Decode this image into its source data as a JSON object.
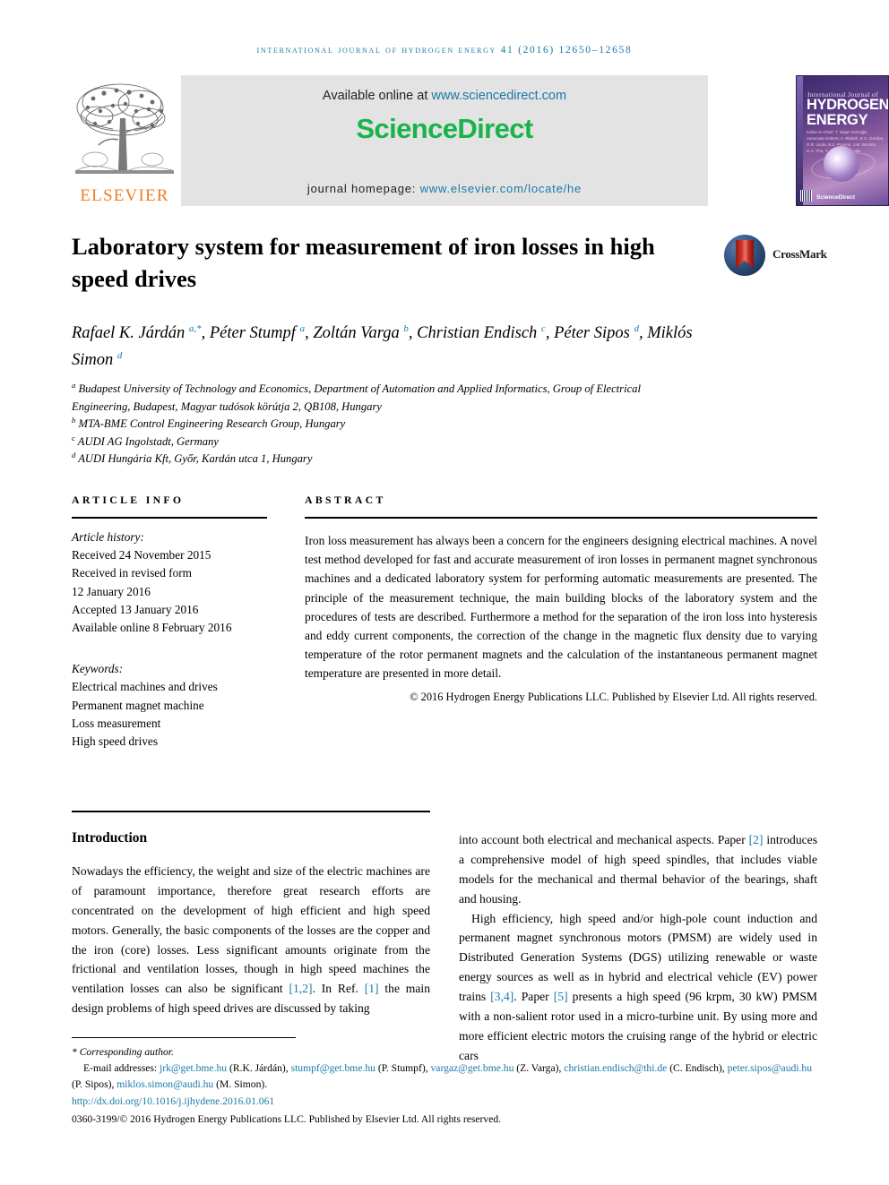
{
  "running_head": "International Journal of Hydrogen Energy 41 (2016) 12650–12658",
  "masthead": {
    "publisher_name": "ELSEVIER",
    "available_prefix": "Available online at ",
    "available_url": "www.sciencedirect.com",
    "sciencedirect_part1": "Science",
    "sciencedirect_part2": "Direct",
    "homepage_label": "journal homepage: ",
    "homepage_url": "www.elsevier.com/locate/he",
    "cover": {
      "line_small": "International Journal of",
      "line_big1": "HYDROGEN",
      "line_big2": "ENERGY",
      "editors": "Editor-in-Chief: T. Nejat Veziroğlu\nAssociate Editors: A. Bloksh, E.C. Gordon, D.R. Linda,\nB.Z. Provins, J.M. Bockris,\nG.A. Thu, T. and C. Padovalle",
      "footer_note": "Available online at ScienceDirect",
      "sd_mark": "ScienceDirect"
    }
  },
  "article": {
    "title": "Laboratory system for measurement of iron losses in high speed drives",
    "crossmark_label": "CrossMark",
    "authors_html": "Rafael K. Járdán <sup>a,*</sup>, Péter Stumpf <sup>a</sup>, Zoltán Varga <sup>b</sup>, Christian Endisch <sup>c</sup>, Péter Sipos <sup>d</sup>, Miklós Simon <sup>d</sup>",
    "affiliations": [
      {
        "marker": "a",
        "text": "Budapest University of Technology and Economics, Department of Automation and Applied Informatics, Group of Electrical Engineering, Budapest, Magyar tudósok körútja 2, QB108, Hungary"
      },
      {
        "marker": "b",
        "text": "MTA-BME Control Engineering Research Group, Hungary"
      },
      {
        "marker": "c",
        "text": "AUDI AG Ingolstadt, Germany"
      },
      {
        "marker": "d",
        "text": "AUDI Hungária Kft, Győr, Kardán utca 1, Hungary"
      }
    ]
  },
  "article_info": {
    "heading": "ARTICLE INFO",
    "history_label": "Article history:",
    "history_lines": [
      "Received 24 November 2015",
      "Received in revised form",
      "12 January 2016",
      "Accepted 13 January 2016",
      "Available online 8 February 2016"
    ],
    "keywords_label": "Keywords:",
    "keywords": [
      "Electrical machines and drives",
      "Permanent magnet machine",
      "Loss measurement",
      "High speed drives"
    ]
  },
  "abstract": {
    "heading": "ABSTRACT",
    "text": "Iron loss measurement has always been a concern for the engineers designing electrical machines. A novel test method developed for fast and accurate measurement of iron losses in permanent magnet synchronous machines and a dedicated laboratory system for performing automatic measurements are presented. The principle of the measurement technique, the main building blocks of the laboratory system and the procedures of tests are described. Furthermore a method for the separation of the iron loss into hysteresis and eddy current components, the correction of the change in the magnetic flux density due to varying temperature of the rotor permanent magnets and the calculation of the instantaneous permanent magnet temperature are presented in more detail.",
    "copyright": "© 2016 Hydrogen Energy Publications LLC. Published by Elsevier Ltd. All rights reserved."
  },
  "body": {
    "section_title": "Introduction",
    "left_paragraph_html": "Nowadays the efficiency, the weight and size of the electric machines are of paramount importance, therefore great research efforts are concentrated on the development of high efficient and high speed motors. Generally, the basic components of the losses are the copper and the iron (core) losses. Less significant amounts originate from the frictional and ventilation losses, though in high speed machines the ventilation losses can also be significant <span class=\"cite\">[1,2]</span>. In Ref. <span class=\"cite\">[1]</span> the main design problems of high speed drives are discussed by taking",
    "right_paragraph1_html": "into account both electrical and mechanical aspects. Paper <span class=\"cite\">[2]</span> introduces a comprehensive model of high speed spindles, that includes viable models for the mechanical and thermal behavior of the bearings, shaft and housing.",
    "right_paragraph2_html": "High efficiency, high speed and/or high-pole count induction and permanent magnet synchronous motors (PMSM) are widely used in Distributed Generation Systems (DGS) utilizing renewable or waste energy sources as well as in hybrid and electrical vehicle (EV) power trains <span class=\"cite\">[3,4]</span>. Paper <span class=\"cite\">[5]</span> presents a high speed (96 krpm, 30 kW) PMSM with a non-salient rotor used in a micro-turbine unit. By using more and more efficient electric motors the cruising range of the hybrid or electric cars"
  },
  "footer": {
    "corresponding": "* Corresponding author.",
    "emails_html": "E-mail addresses: <span class=\"mail\">jrk@get.bme.hu</span> (R.K. Járdán), <span class=\"mail\">stumpf@get.bme.hu</span> (P. Stumpf), <span class=\"mail\">vargaz@get.bme.hu</span> (Z. Varga), <span class=\"mail\">christian.endisch@thi.de</span> (C. Endisch), <span class=\"mail\">peter.sipos@audi.hu</span> (P. Sipos), <span class=\"mail\">miklos.simon@audi.hu</span> (M. Simon).",
    "doi": "http://dx.doi.org/10.1016/j.ijhydene.2016.01.061",
    "issn_line": "0360-3199/© 2016 Hydrogen Energy Publications LLC. Published by Elsevier Ltd. All rights reserved."
  },
  "colors": {
    "link_blue": "#1879a8",
    "elsevier_orange": "#ef7d22",
    "sciencedirect_green": "#19b34a",
    "banner_gray": "#e3e3e3"
  }
}
